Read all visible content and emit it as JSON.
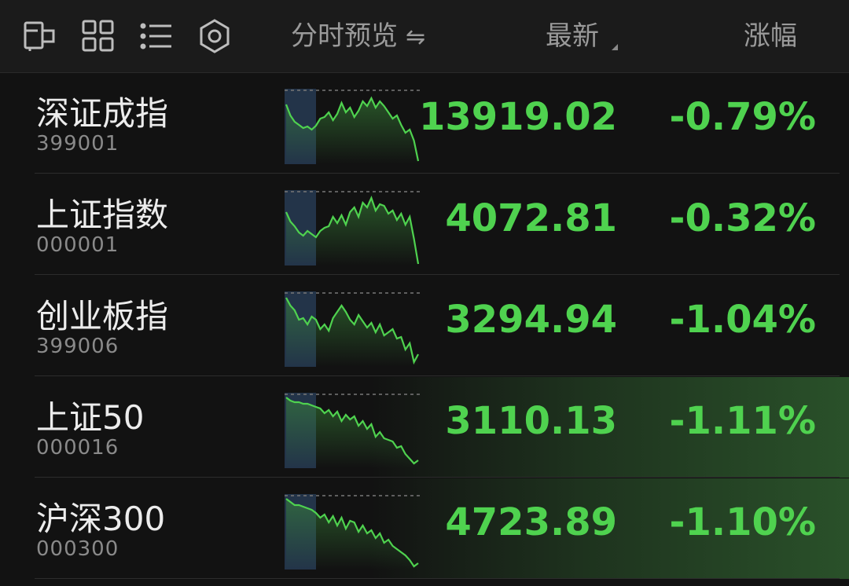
{
  "header": {
    "icons": [
      "layout-toggle-icon",
      "grid-view-icon",
      "list-view-icon",
      "settings-icon"
    ],
    "intraday_label": "分时预览",
    "swap_symbol": "⇋",
    "latest_label": "最新",
    "change_label": "涨幅"
  },
  "colors": {
    "down_green": "#4fd24f",
    "background": "#121212",
    "header_bg": "#1b1b1b",
    "pre_market_band": "#233449"
  },
  "rows": [
    {
      "name": "深证成指",
      "code": "399001",
      "price": "13919.02",
      "change": "-0.79%",
      "highlight": false,
      "spark": [
        20,
        34,
        42,
        46,
        50,
        48,
        52,
        47,
        38,
        36,
        30,
        40,
        32,
        18,
        30,
        24,
        36,
        28,
        16,
        22,
        12,
        24,
        16,
        22,
        30,
        38,
        34,
        46,
        56,
        52,
        66,
        92
      ]
    },
    {
      "name": "上证指数",
      "code": "000001",
      "price": "4072.81",
      "change": "-0.32%",
      "highlight": false,
      "spark": [
        28,
        40,
        46,
        54,
        58,
        52,
        56,
        60,
        52,
        48,
        46,
        34,
        42,
        32,
        44,
        28,
        22,
        34,
        16,
        22,
        10,
        26,
        18,
        20,
        30,
        26,
        38,
        30,
        44,
        34,
        62,
        94
      ]
    },
    {
      "name": "创业板指",
      "code": "399006",
      "price": "3294.94",
      "change": "-1.04%",
      "highlight": false,
      "spark": [
        8,
        18,
        24,
        36,
        34,
        42,
        32,
        36,
        48,
        42,
        50,
        34,
        26,
        18,
        26,
        36,
        42,
        30,
        38,
        46,
        40,
        52,
        42,
        56,
        52,
        48,
        60,
        58,
        74,
        66,
        90,
        80
      ]
    },
    {
      "name": "上证50",
      "code": "000016",
      "price": "3110.13",
      "change": "-1.11%",
      "highlight": true,
      "spark": [
        6,
        10,
        12,
        12,
        14,
        14,
        16,
        18,
        20,
        26,
        22,
        30,
        24,
        36,
        28,
        34,
        30,
        42,
        36,
        46,
        40,
        56,
        50,
        58,
        60,
        62,
        70,
        68,
        78,
        84,
        90,
        86
      ]
    },
    {
      "name": "沪深300",
      "code": "000300",
      "price": "4723.89",
      "change": "-1.10%",
      "highlight": true,
      "spark": [
        6,
        10,
        14,
        14,
        16,
        18,
        20,
        24,
        30,
        26,
        36,
        28,
        40,
        30,
        44,
        34,
        36,
        48,
        40,
        50,
        46,
        56,
        50,
        62,
        58,
        66,
        70,
        74,
        78,
        84,
        92,
        88
      ]
    }
  ]
}
